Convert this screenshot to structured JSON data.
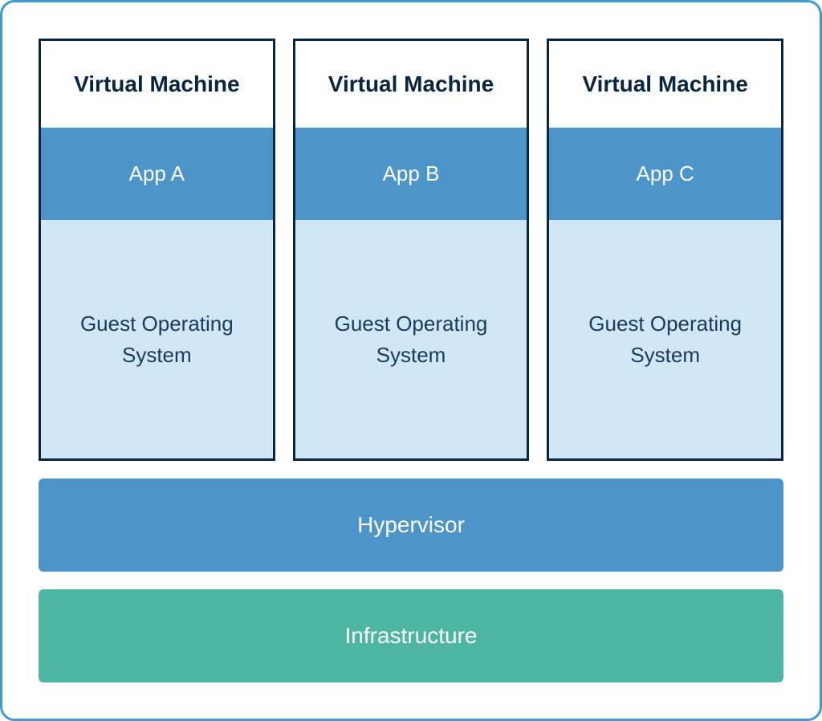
{
  "vms": [
    {
      "title": "Virtual Machine",
      "app": "App A",
      "guest_os": "Guest Operating System"
    },
    {
      "title": "Virtual Machine",
      "app": "App B",
      "guest_os": "Guest Operating System"
    },
    {
      "title": "Virtual Machine",
      "app": "App C",
      "guest_os": "Guest Operating System"
    }
  ],
  "hypervisor": "Hypervisor",
  "infrastructure": "Infrastructure",
  "colors": {
    "border_blue": "#4099d4",
    "dark_navy": "#0a2540",
    "mid_blue": "#4d94c9",
    "light_blue": "#d0e7f5",
    "teal": "#4db6a0"
  }
}
